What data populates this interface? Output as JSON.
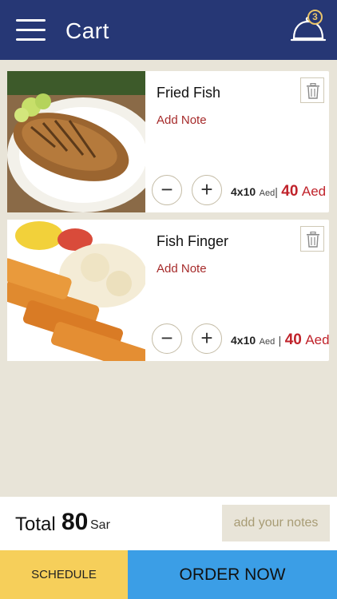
{
  "header": {
    "title": "Cart",
    "menu_icon": "hamburger-menu-icon",
    "cart_icon": "serving-cloche-icon",
    "cart_count": "3"
  },
  "items": [
    {
      "name": "Fried Fish",
      "add_note": "Add Note",
      "qty_text": "4x10",
      "unit": "Aed",
      "separator": "|",
      "price": "40",
      "currency": "Aed",
      "image_icon": "fried-fish-photo"
    },
    {
      "name": "Fish Finger",
      "add_note": "Add Note",
      "qty_text": "4x10",
      "unit": "Aed",
      "separator": "|",
      "price": "40",
      "currency": "Aed",
      "image_icon": "fish-finger-photo"
    }
  ],
  "controls": {
    "minus": "−",
    "plus": "+",
    "trash_icon": "trash-icon"
  },
  "footer": {
    "total_label": "Total",
    "total_value": "80",
    "total_currency": "Sar",
    "notes_button": "add your notes",
    "schedule_button": "SCHEDULE",
    "order_button": "ORDER NOW"
  },
  "colors": {
    "header_bg": "#263775",
    "page_bg": "#e8e4d8",
    "price_red": "#c0232b",
    "schedule_yellow": "#f6cf5a",
    "order_blue": "#3b9ee6"
  }
}
